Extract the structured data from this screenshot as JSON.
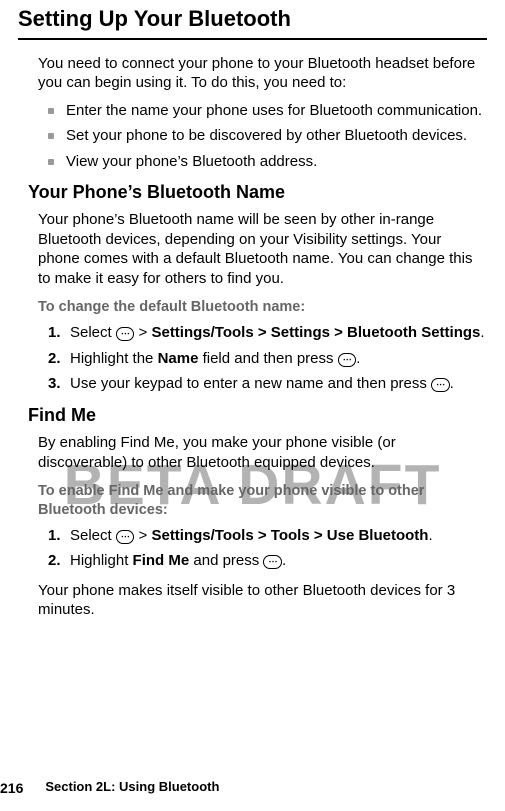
{
  "watermark": "BETA DRAFT",
  "title": "Setting Up Your Bluetooth",
  "intro": "You need to connect your phone to your Bluetooth headset before you can begin using it. To do this, you need to:",
  "bullets": [
    "Enter the name your phone uses for Bluetooth communication.",
    "Set your phone to be discovered by other Bluetooth devices.",
    "View your phone’s Bluetooth address."
  ],
  "section1": {
    "heading": "Your Phone’s Bluetooth Name",
    "para": "Your phone’s Bluetooth name will be seen by other in-range Bluetooth devices, depending on your Visibility settings. Your phone comes with a default Bluetooth name. You can change this to make it easy for others to find you.",
    "subhead": "To change the default Bluetooth name:",
    "steps": [
      {
        "num": "1.",
        "pre": "Select ",
        "icon": "⋯",
        "post": " > ",
        "bold": "Settings/Tools > Settings > Bluetooth Settings",
        "tail": "."
      },
      {
        "num": "2.",
        "pre": "Highlight the ",
        "bold": "Name",
        "mid": " field and then press ",
        "icon": "⋯",
        "tail": "."
      },
      {
        "num": "3.",
        "pre": "Use your keypad to enter a new name and then press ",
        "icon": "⋯",
        "tail": "."
      }
    ]
  },
  "section2": {
    "heading": "Find Me",
    "para": "By enabling Find Me, you make your phone visible (or discoverable) to other Bluetooth equipped devices.",
    "subhead": "To enable Find Me and make your phone visible to other Bluetooth devices:",
    "steps": [
      {
        "num": "1.",
        "pre": "Select ",
        "icon": "⋯",
        "post": " > ",
        "bold": "Settings/Tools > Tools > Use Bluetooth",
        "tail": "."
      },
      {
        "num": "2.",
        "pre": "Highlight ",
        "bold": "Find Me",
        "mid": " and press ",
        "icon": "⋯",
        "tail": "."
      }
    ],
    "closing": "Your phone makes itself visible to other Bluetooth devices for 3 minutes."
  },
  "footer": {
    "page": "216",
    "section": "Section 2L: Using Bluetooth"
  }
}
